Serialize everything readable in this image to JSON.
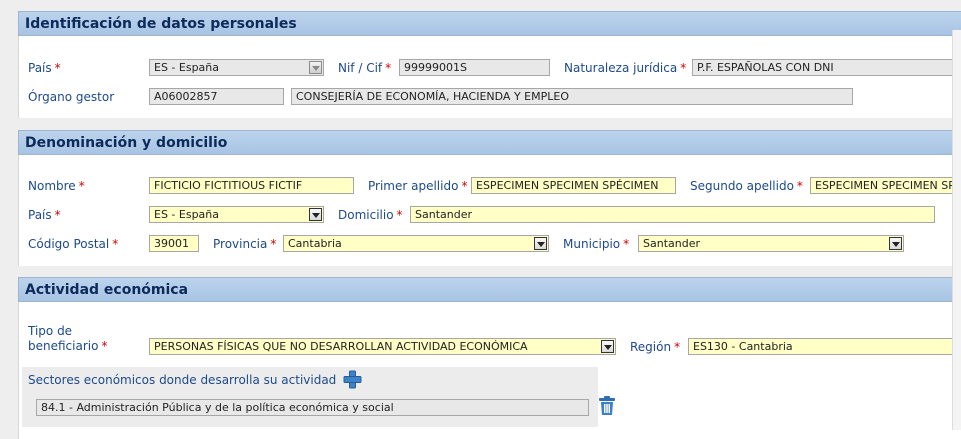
{
  "section1": {
    "title": "Identificación de datos personales",
    "pais_label": "País",
    "pais_value": "ES - España",
    "nif_label": "Nif / Cif",
    "nif_value": "99999001S",
    "naturaleza_label": "Naturaleza jurídica",
    "naturaleza_value": "P.F. ESPAÑOLAS CON DNI",
    "organo_label": "Órgano gestor",
    "organo_code": "A06002857",
    "organo_name": "CONSEJERÍA DE ECONOMÍA, HACIENDA Y EMPLEO"
  },
  "section2": {
    "title": "Denominación y domicilio",
    "nombre_label": "Nombre",
    "nombre_value": "FICTICIO FICTITIOUS FICTIF",
    "apellido1_label": "Primer apellido",
    "apellido1_value": "ESPECIMEN SPECIMEN SPÉCIMEN",
    "apellido2_label": "Segundo apellido",
    "apellido2_value": "ESPECIMEN SPECIMEN SPÉCIMEN",
    "pais_label": "País",
    "pais_value": "ES - España",
    "domicilio_label": "Domicilio",
    "domicilio_value": "Santander",
    "cp_label": "Código Postal",
    "cp_value": "39001",
    "provincia_label": "Provincia",
    "provincia_value": "Cantabria",
    "municipio_label": "Municipio",
    "municipio_value": "Santander"
  },
  "section3": {
    "title": "Actividad económica",
    "tipo_label_1": "Tipo de",
    "tipo_label_2": "beneficiario",
    "tipo_value": "PERSONAS FÍSICAS QUE NO DESARROLLAN ACTIVIDAD ECONÓMICA",
    "region_label": "Región",
    "region_value": "ES130 - Cantabria",
    "sectores_label": "Sectores económicos donde desarrolla su actividad",
    "sector_item": "84.1 - Administración Pública y de la política económica y social"
  },
  "common": {
    "required_mark": "*"
  },
  "icons": {
    "add": "plus-icon",
    "delete": "trash-icon"
  },
  "colors": {
    "header": "#b2cbe8",
    "required": "#d40000",
    "label": "#1d4a8a",
    "highlight": "#ffffc6"
  }
}
